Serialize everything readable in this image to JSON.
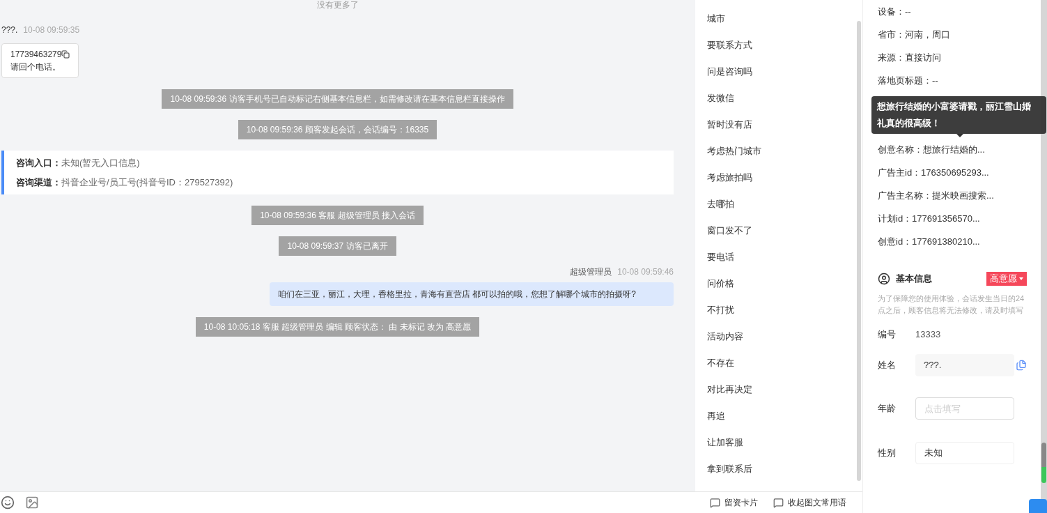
{
  "chat": {
    "top_notice": "没有更多了",
    "messages": [
      {
        "kind": "visitor",
        "sender": "???.",
        "time": "10-08 09:59:35",
        "phone": "17739463279",
        "text": "请回个电话。"
      },
      {
        "kind": "system",
        "text": "10-08 09:59:36 访客手机号已自动标记右侧基本信息栏，如需修改请在基本信息栏直接操作"
      },
      {
        "kind": "system",
        "text": "10-08 09:59:36 顾客发起会话，会话编号：16335"
      },
      {
        "kind": "source",
        "rows": [
          {
            "label": "咨询入口：",
            "value": "未知(暂无入口信息)"
          },
          {
            "label": "咨询渠道：",
            "value": "抖音企业号/员工号(抖音号ID：279527392)"
          }
        ]
      },
      {
        "kind": "system",
        "text": "10-08 09:59:36 客服 超级管理员 接入会话"
      },
      {
        "kind": "system",
        "text": "10-08 09:59:37 访客已离开"
      },
      {
        "kind": "agent",
        "sender": "超级管理员",
        "time": "10-08 09:59:46",
        "text": "咱们在三亚，丽江，大理，香格里拉，青海有直营店 都可以拍的哦，您想了解哪个城市的拍摄呀?"
      },
      {
        "kind": "system",
        "text": "10-08 10:05:18 客服 超级管理员 编辑 顾客状态： 由 未标记 改为 高意愿"
      }
    ]
  },
  "toolbar": {
    "actions": [
      "留资卡片",
      "收起图文常用语"
    ]
  },
  "quick_replies": [
    "城市",
    "要联系方式",
    "问是咨询吗",
    "发微信",
    "暂时没有店",
    "考虑热门城市",
    "考虑旅拍吗",
    "去哪拍",
    "窗口发不了",
    "要电话",
    "问价格",
    "不打扰",
    "活动内容",
    "不存在",
    "对比再决定",
    "再追",
    "让加客服",
    "拿到联系后"
  ],
  "visitor_info": {
    "rows_above": [
      "设备：--",
      "省市：河南，周口",
      "来源：直接访问",
      "落地页标题：--"
    ],
    "tooltip": "想旅行结婚的小富婆请戳，丽江雪山婚礼真的很高级！",
    "rows_below": [
      "创意名称：想旅行结婚的...",
      "广告主id：176350695293...",
      "广告主名称：提米映画搜索...",
      "计划id：177691356570...",
      "创意id：177691380210..."
    ]
  },
  "basic_info": {
    "title": "基本信息",
    "tag": "高意愿",
    "notice": "为了保障您的使用体验，会话发生当日的24点之后，顾客信息将无法修改，请及时填写",
    "fields": [
      {
        "kind": "text",
        "label": "编号",
        "value": "13333"
      },
      {
        "kind": "readonly",
        "label": "姓名",
        "value": "???."
      },
      {
        "kind": "input",
        "label": "年龄",
        "placeholder": "点击填写"
      },
      {
        "kind": "select",
        "label": "性别",
        "value": "未知"
      }
    ]
  }
}
